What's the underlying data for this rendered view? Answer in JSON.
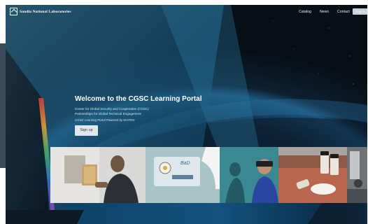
{
  "brand": {
    "name": "Sandia National Laboratories",
    "icon": "sandia-thunderbird-logo"
  },
  "nav": {
    "items": [
      "Catalog",
      "News",
      "Contact"
    ],
    "login_label": "Log in"
  },
  "hero": {
    "title": "Welcome to the CGSC Learning Portal",
    "subtitle_line1": "Center for Global Security and Cooperation (CGSC)",
    "subtitle_line2": "Partnerships for Global Technical Engagement",
    "powered_by": "CGSC Learning Portal Powered by MATRIX",
    "signup_label": "Sign up"
  },
  "photos": [
    {
      "icon": "researcher-lab-photo"
    },
    {
      "icon": "glovebox-sample-photo"
    },
    {
      "icon": "vr-headset-photo"
    },
    {
      "icon": "sample-vials-photo"
    },
    {
      "icon": "lab-equipment-photo"
    }
  ],
  "colors": {
    "deep_space": "#0a1622",
    "earth_blue": "#1a4c72",
    "teal_band": "#1e6a8e",
    "band_light": "#5aa6c8"
  }
}
